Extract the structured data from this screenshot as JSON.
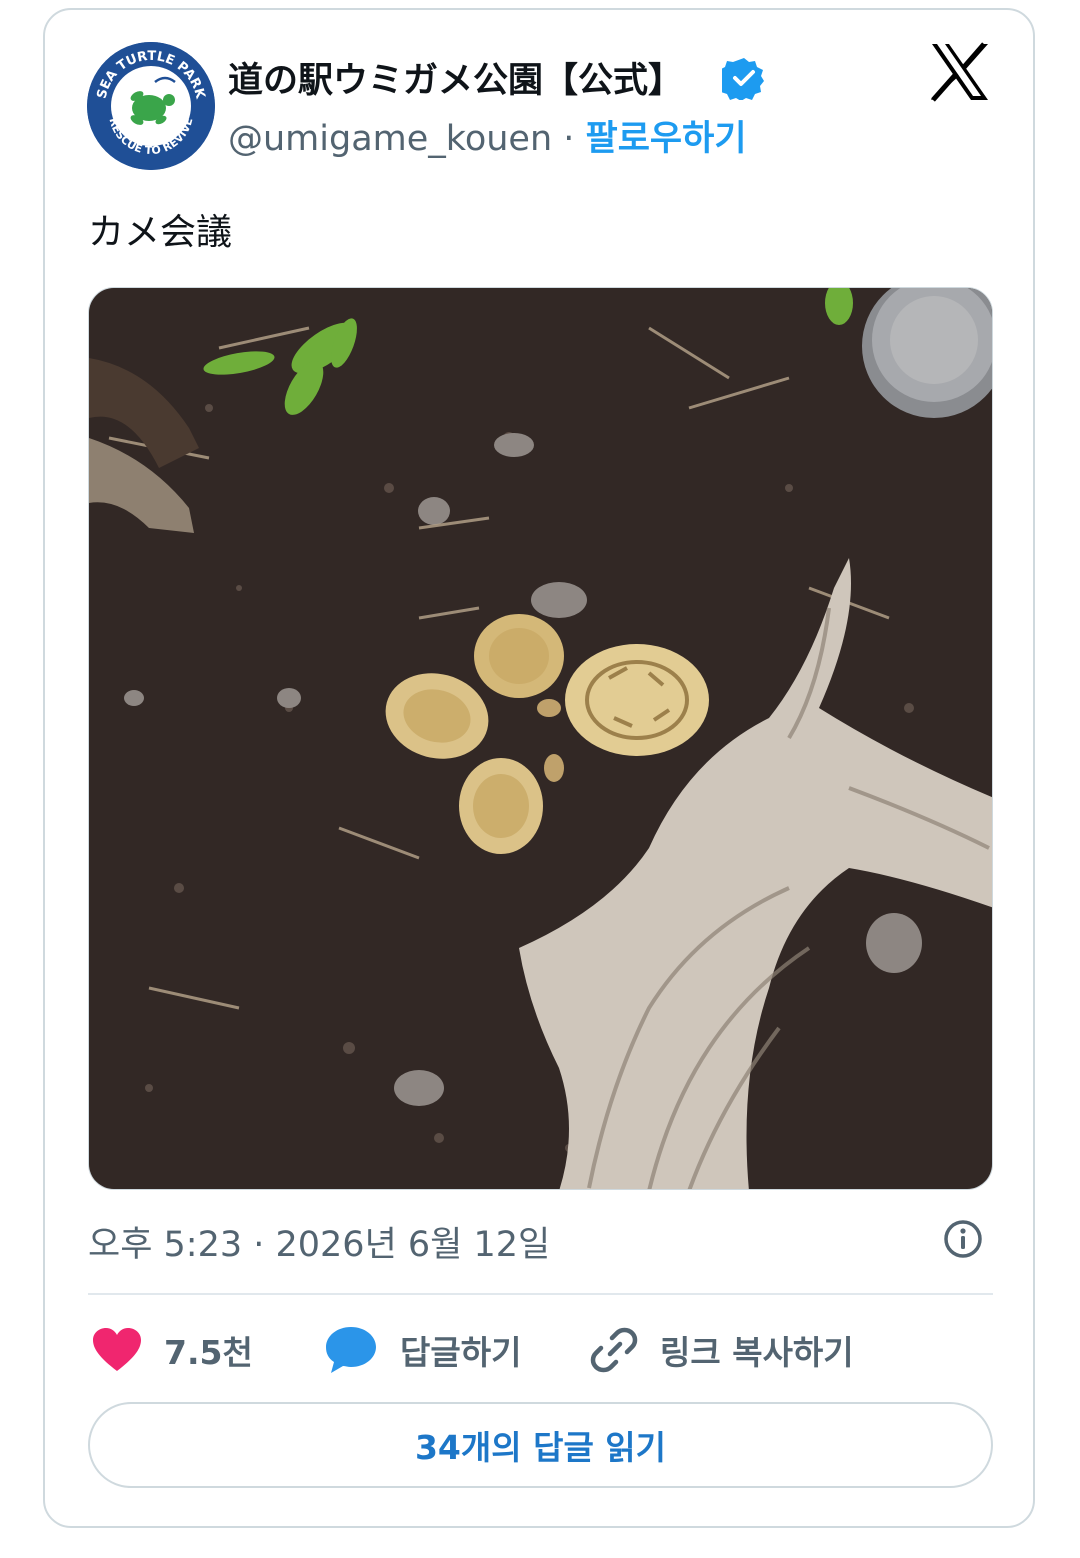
{
  "account": {
    "display_name": "道の駅ウミガメ公園【公式】",
    "handle": "@umigame_kouen",
    "separator": " · ",
    "follow_label": "팔로우하기",
    "avatar_lettering": [
      "SEA TURTLE PARK",
      "RESCUE TO REVIVE"
    ]
  },
  "tweet": {
    "text": "カメ会議",
    "timestamp": "오후 5:23 · 2026년 6월 12일"
  },
  "actions": {
    "likes": "7.5천",
    "reply_label": "답글하기",
    "copy_link_label": "링크 복사하기"
  },
  "read_replies_label": "34개의 답글 읽기",
  "colors": {
    "accent": "#1d9bf0",
    "like_heart": "#f0266f",
    "reply_bubble": "#2b95e9",
    "secondary_text": "#536471",
    "border": "#cfd9de"
  },
  "icons": [
    "verified-badge-icon",
    "x-logo-icon",
    "info-icon",
    "heart-icon",
    "speech-bubble-icon",
    "link-icon"
  ]
}
